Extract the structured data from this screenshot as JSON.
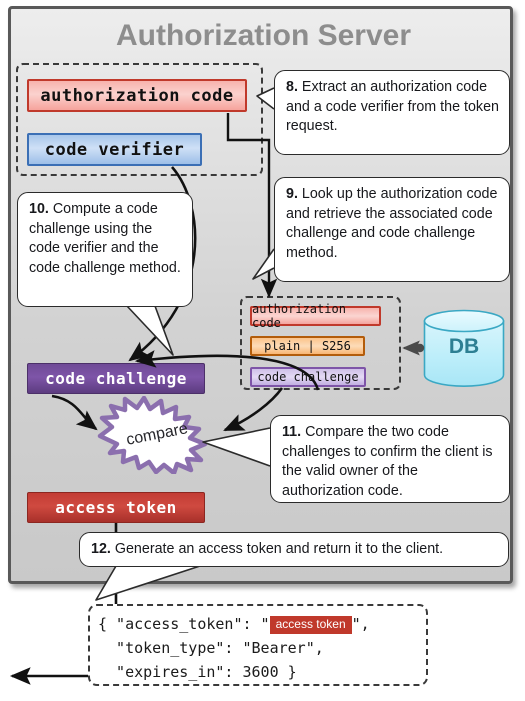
{
  "panel": {
    "title": "Authorization Server"
  },
  "request_group": {
    "authorization_code": "authorization code",
    "code_verifier": "code verifier"
  },
  "store_group": {
    "authorization_code": "authorization code",
    "code_challenge_method": "plain | S256",
    "code_challenge": "code challenge"
  },
  "database": {
    "label": "DB"
  },
  "computed": {
    "code_challenge": "code challenge",
    "access_token": "access token"
  },
  "compare": {
    "label": "compare"
  },
  "callouts": {
    "step8": {
      "number": "8.",
      "text": "Extract an authorization code and a code verifier from the token request."
    },
    "step9": {
      "number": "9.",
      "text": "Look up the authorization code and retrieve the associated code challenge and code challenge method."
    },
    "step10": {
      "number": "10.",
      "text": "Compute a code challenge using the code verifier and the code challenge method."
    },
    "step11": {
      "number": "11.",
      "text": "Compare the two code challenges to confirm the client is the valid owner of the authorization code."
    },
    "step12": {
      "number": "12.",
      "text": "Generate an access token and return it to the client."
    }
  },
  "json_response": {
    "line1_prefix": "{ \"access_token\": \"",
    "token_badge": "access token",
    "line1_suffix": "\",",
    "line2": "  \"token_type\": \"Bearer\",",
    "line3": "  \"expires_in\": 3600 }"
  },
  "colors": {
    "panel_border": "#595959",
    "panel_title": "#8d8d8d",
    "auth_code_red": "#c0392b",
    "code_verifier_blue": "#3b6fb5",
    "code_challenge_purple": "#7e55a8",
    "access_token_red": "#c23b33",
    "method_orange": "#b35c0a",
    "db_teal": "#2d7f93",
    "db_fill": "#b8ecf7"
  }
}
